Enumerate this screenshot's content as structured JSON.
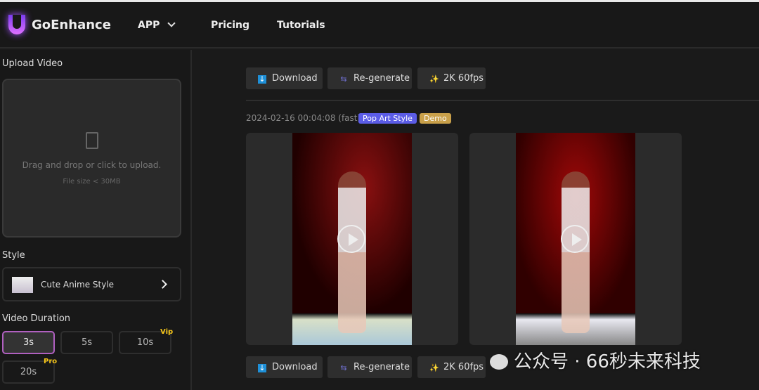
{
  "nav": {
    "brand": "GoEnhance",
    "items": [
      "APP",
      "Pricing",
      "Tutorials"
    ]
  },
  "sidebar": {
    "upload_label": "Upload Video",
    "upload_hint": "Drag and drop or click to upload.",
    "upload_limit": "File size < 30MB",
    "style_label": "Style",
    "style_value": "Cute Anime Style",
    "duration_label": "Video Duration",
    "durations": [
      {
        "label": "3s",
        "selected": true
      },
      {
        "label": "5s"
      },
      {
        "label": "10s",
        "badge": "Vip"
      },
      {
        "label": "20s",
        "badge": "Pro"
      }
    ]
  },
  "toolbar": {
    "download": "Download",
    "regenerate": "Re-generate",
    "upscale": "2K 60fps"
  },
  "result": {
    "timestamp": "2024-02-16 00:04:08 (fast)",
    "style_tag": "Pop Art Style",
    "demo_tag": "Demo"
  },
  "colors": {
    "style_tag": "#5b5ce6",
    "demo_tag": "#c9a04a",
    "badge": "#f5c518"
  },
  "watermark": "公众号 · 66秒未来科技"
}
